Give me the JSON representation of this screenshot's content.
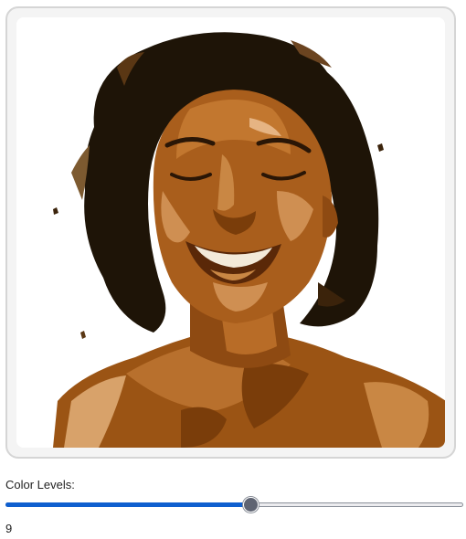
{
  "image": {
    "description_icon": "posterized-portrait-image"
  },
  "controls": {
    "color_levels_label": "Color Levels:",
    "color_levels_value": "9",
    "slider_min": 2,
    "slider_max": 16,
    "slider_fraction": 0.536
  },
  "colors": {
    "accent": "#0f5fcf",
    "thumb": "#5f6472",
    "hair": "#1e1407",
    "skin_dark": "#7a3d0a",
    "skin_mid": "#a95e1c",
    "skin_light": "#cf8f52",
    "highlight": "#e6b483",
    "teeth": "#f3ead9"
  }
}
